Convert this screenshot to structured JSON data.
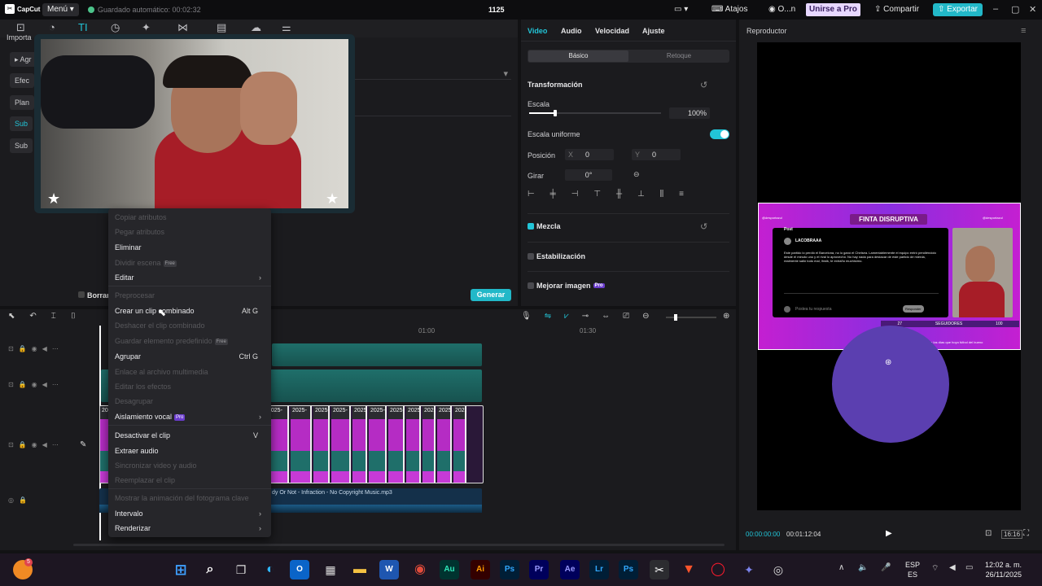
{
  "titlebar": {
    "app_name": "CapCut",
    "menu_label": "Menú",
    "autosave": "Guardado automático: 00:02:32",
    "project_title": "1125",
    "shortcuts_label": "Atajos",
    "user_label": "O...n",
    "pro_label": "Unirse a Pro",
    "share_label": "Compartir",
    "export_label": "Exportar"
  },
  "left_panel": {
    "import_label": "Importa",
    "items": [
      "Agr",
      "Efec",
      "Plan",
      "Sub",
      "Sub"
    ],
    "delete_label": "Borrar",
    "generate_label": "Generar"
  },
  "properties": {
    "tabs": [
      "Video",
      "Audio",
      "Velocidad",
      "Ajuste"
    ],
    "seg_basic": "Básico",
    "seg_retouch": "Retoque",
    "transform_header": "Transformación",
    "scale_label": "Escala",
    "scale_value": "100%",
    "scale_level": 0.2,
    "uniform_label": "Escala uniforme",
    "position_label": "Posición",
    "pos_x_label": "X",
    "pos_x": "0",
    "pos_y_label": "Y",
    "pos_y": "0",
    "rotate_label": "Girar",
    "rotate_value": "0°",
    "blend_label": "Mezcla",
    "stabilize_label": "Estabilización",
    "enhance_label": "Mejorar imagen",
    "enhance_badge": "Pro"
  },
  "player": {
    "title": "Reproductor",
    "current_time": "00:00:00:00",
    "total_time": "00:01:12:04",
    "ratio_label": "16:16",
    "preview": {
      "banner": "FINTA DISRUPTIVA",
      "handle": "@desportazul",
      "post_title": "Post",
      "account": "LACOBRAAA",
      "tweet": "Este partido lo perdió el Barcelona, no lo ganó el Chelsea. Lamentablemente el equipo entró pendiéndolo desde el minuto uno y el rival lo aprovechó. No hay nada para destacar de este partido de mierda, realmente salió todo mal, Ihwik, te extraño muchísimo.",
      "reply_placeholder": "Postea tu respuesta",
      "reply_btn": "Responder",
      "stat_1": "27",
      "stat_label": "SEGUIDORES",
      "stat_2": "100",
      "footer": "te los días que hoyo fútbol del bueno"
    }
  },
  "timeline": {
    "time_1": "01:00",
    "time_2": "01:30",
    "clip_label": "2025-",
    "audio_label": "dy Or Not - Infraction - No Copyright Music.mp3"
  },
  "context_menu": {
    "items": [
      {
        "label": "Copiar atributos",
        "disabled": true
      },
      {
        "label": "Pegar atributos",
        "disabled": true
      },
      {
        "label": "Eliminar",
        "disabled": false
      },
      {
        "label": "Dividir escena",
        "disabled": true,
        "badge": "Free"
      },
      {
        "label": "Editar",
        "disabled": false,
        "submenu": true
      },
      {
        "label": "Preprocesar",
        "disabled": true
      },
      {
        "label": "Crear un clip combinado",
        "disabled": false,
        "shortcut": "Alt G"
      },
      {
        "label": "Deshacer el clip combinado",
        "disabled": true
      },
      {
        "label": "Guardar elemento predefinido",
        "disabled": true,
        "badge": "Free"
      },
      {
        "label": "Agrupar",
        "disabled": false,
        "shortcut": "Ctrl G"
      },
      {
        "label": "Enlace al archivo multimedia",
        "disabled": true
      },
      {
        "label": "Editar los efectos",
        "disabled": true
      },
      {
        "label": "Desagrupar",
        "disabled": true
      },
      {
        "label": "Aislamiento vocal",
        "disabled": false,
        "pro": "Pro",
        "submenu": true
      },
      {
        "label": "Desactivar el clip",
        "disabled": false,
        "shortcut": "V"
      },
      {
        "label": "Extraer audio",
        "disabled": false
      },
      {
        "label": "Sincronizar video y audio",
        "disabled": true
      },
      {
        "label": "Reemplazar el clip",
        "disabled": true
      },
      {
        "label": "Mostrar la animación del fotograma clave",
        "disabled": true
      },
      {
        "label": "Intervalo",
        "disabled": false,
        "submenu": true
      },
      {
        "label": "Renderizar",
        "disabled": false,
        "submenu": true
      }
    ]
  },
  "taskbar": {
    "apps": [
      "Au",
      "Ai",
      "Ps",
      "Pr",
      "Ae",
      "Lr",
      "Ps"
    ],
    "lang_1": "ESP",
    "lang_2": "ES",
    "time": "12:02 a. m.",
    "date": "26/11/2025",
    "weather_badge": "5"
  },
  "colors": {
    "accent": "#22c5d8",
    "preview_magenta": "#c41fd1",
    "preview_purple": "#6a36d4",
    "circle": "#5b3fb0"
  }
}
